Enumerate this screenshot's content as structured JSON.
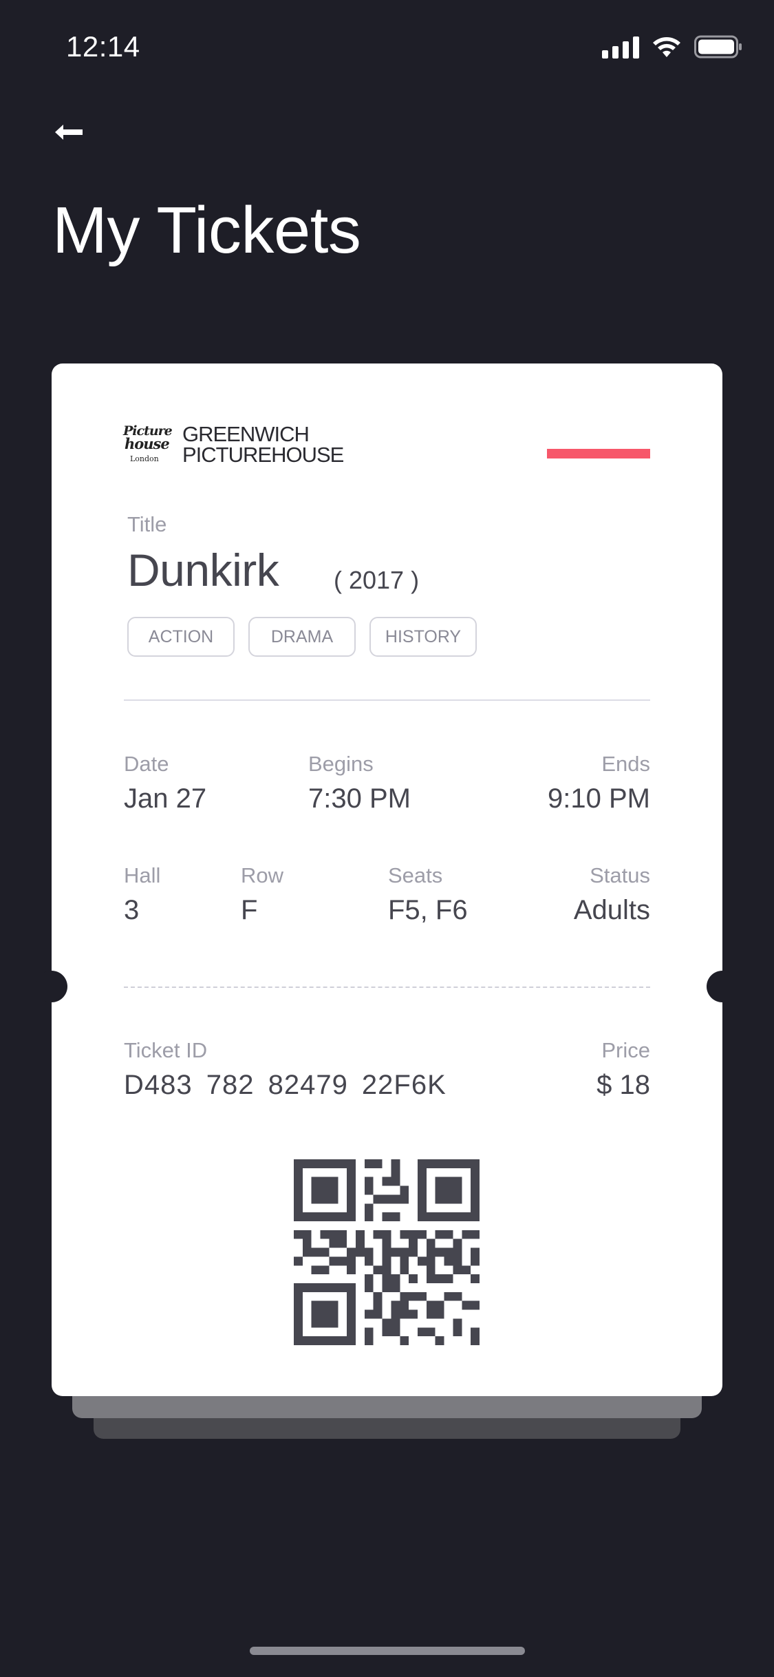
{
  "status_bar": {
    "time": "12:14"
  },
  "header": {
    "back_icon": "arrow-left-icon",
    "title": "My Tickets"
  },
  "ticket": {
    "cinema": {
      "logo_text": [
        "Picture",
        "house",
        "London"
      ],
      "name_line1": "GREENWICH",
      "name_line2": "PICTUREHOUSE"
    },
    "accent_color": "#f7576a",
    "title_label": "Title",
    "title": "Dunkirk",
    "year": "( 2017 )",
    "genres": [
      "ACTION",
      "DRAMA",
      "HISTORY"
    ],
    "date_label": "Date",
    "date": "Jan 27",
    "begins_label": "Begins",
    "begins": "7:30 PM",
    "ends_label": "Ends",
    "ends": "9:10 PM",
    "hall_label": "Hall",
    "hall": "3",
    "row_label": "Row",
    "row": "F",
    "seats_label": "Seats",
    "seats": "F5, F6",
    "status_label": "Status",
    "status": "Adults",
    "ticket_id_label": "Ticket ID",
    "ticket_id": "D483  782  82479  22F6K",
    "price_label": "Price",
    "price": "$ 18",
    "qr_icon": "qr-code-icon"
  },
  "colors": {
    "background": "#1e1e27",
    "card": "#ffffff",
    "text_primary": "#46464f",
    "text_secondary": "#9d9da8"
  }
}
